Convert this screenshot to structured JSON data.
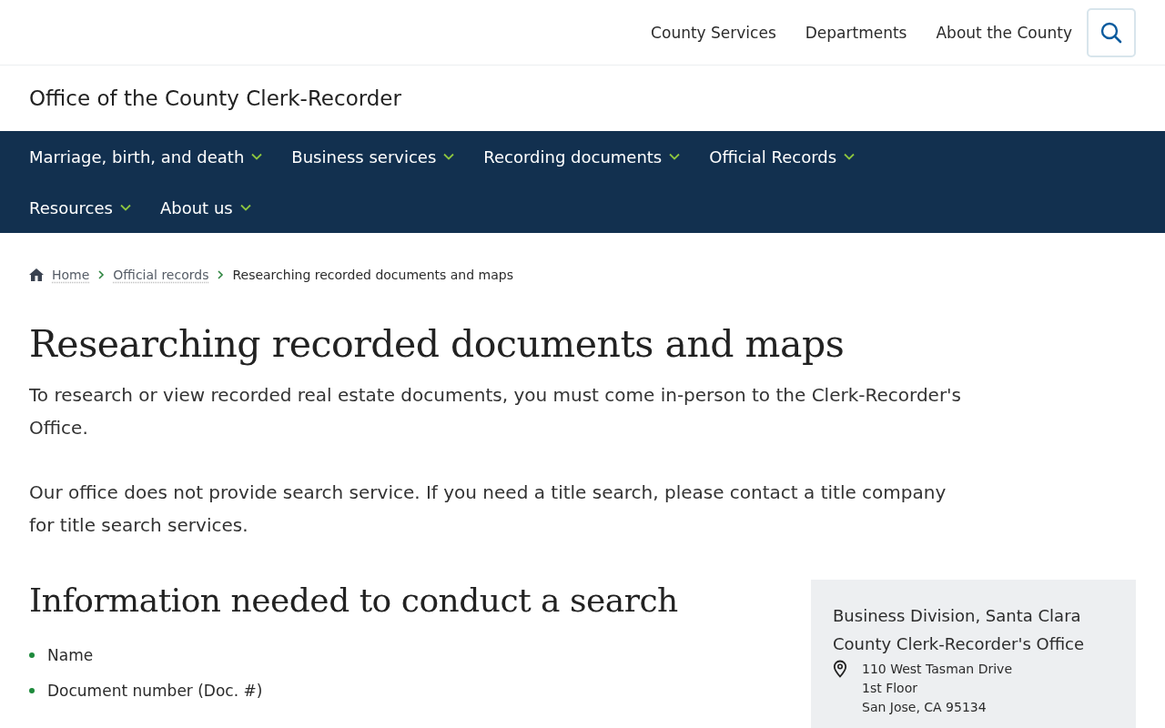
{
  "top_links": [
    "County Services",
    "Departments",
    "About the County"
  ],
  "site_title": "Office of the County Clerk-Recorder",
  "main_nav": [
    {
      "label": "Marriage, birth, and death"
    },
    {
      "label": "Business services"
    },
    {
      "label": "Recording documents"
    },
    {
      "label": "Official Records"
    },
    {
      "label": "Resources"
    },
    {
      "label": "About us"
    }
  ],
  "breadcrumb": {
    "links": [
      "Home",
      "Official records"
    ],
    "current": "Researching recorded documents and maps"
  },
  "title": "Researching recorded documents and maps",
  "paragraphs": [
    "To research or view recorded real estate documents, you must come in-person to the Clerk-Recorder's Office.",
    "Our office does not provide search service. If you need a title search, please contact a title company for title search services."
  ],
  "section": {
    "heading": "Information needed to conduct a search",
    "items": [
      "Name",
      "Document number (Doc. #)"
    ]
  },
  "contact_card": {
    "title": "Business Division, Santa Clara County Clerk-Recorder's Office",
    "address": [
      "110 West Tasman Drive",
      "1st Floor",
      "San Jose, CA 95134"
    ]
  }
}
